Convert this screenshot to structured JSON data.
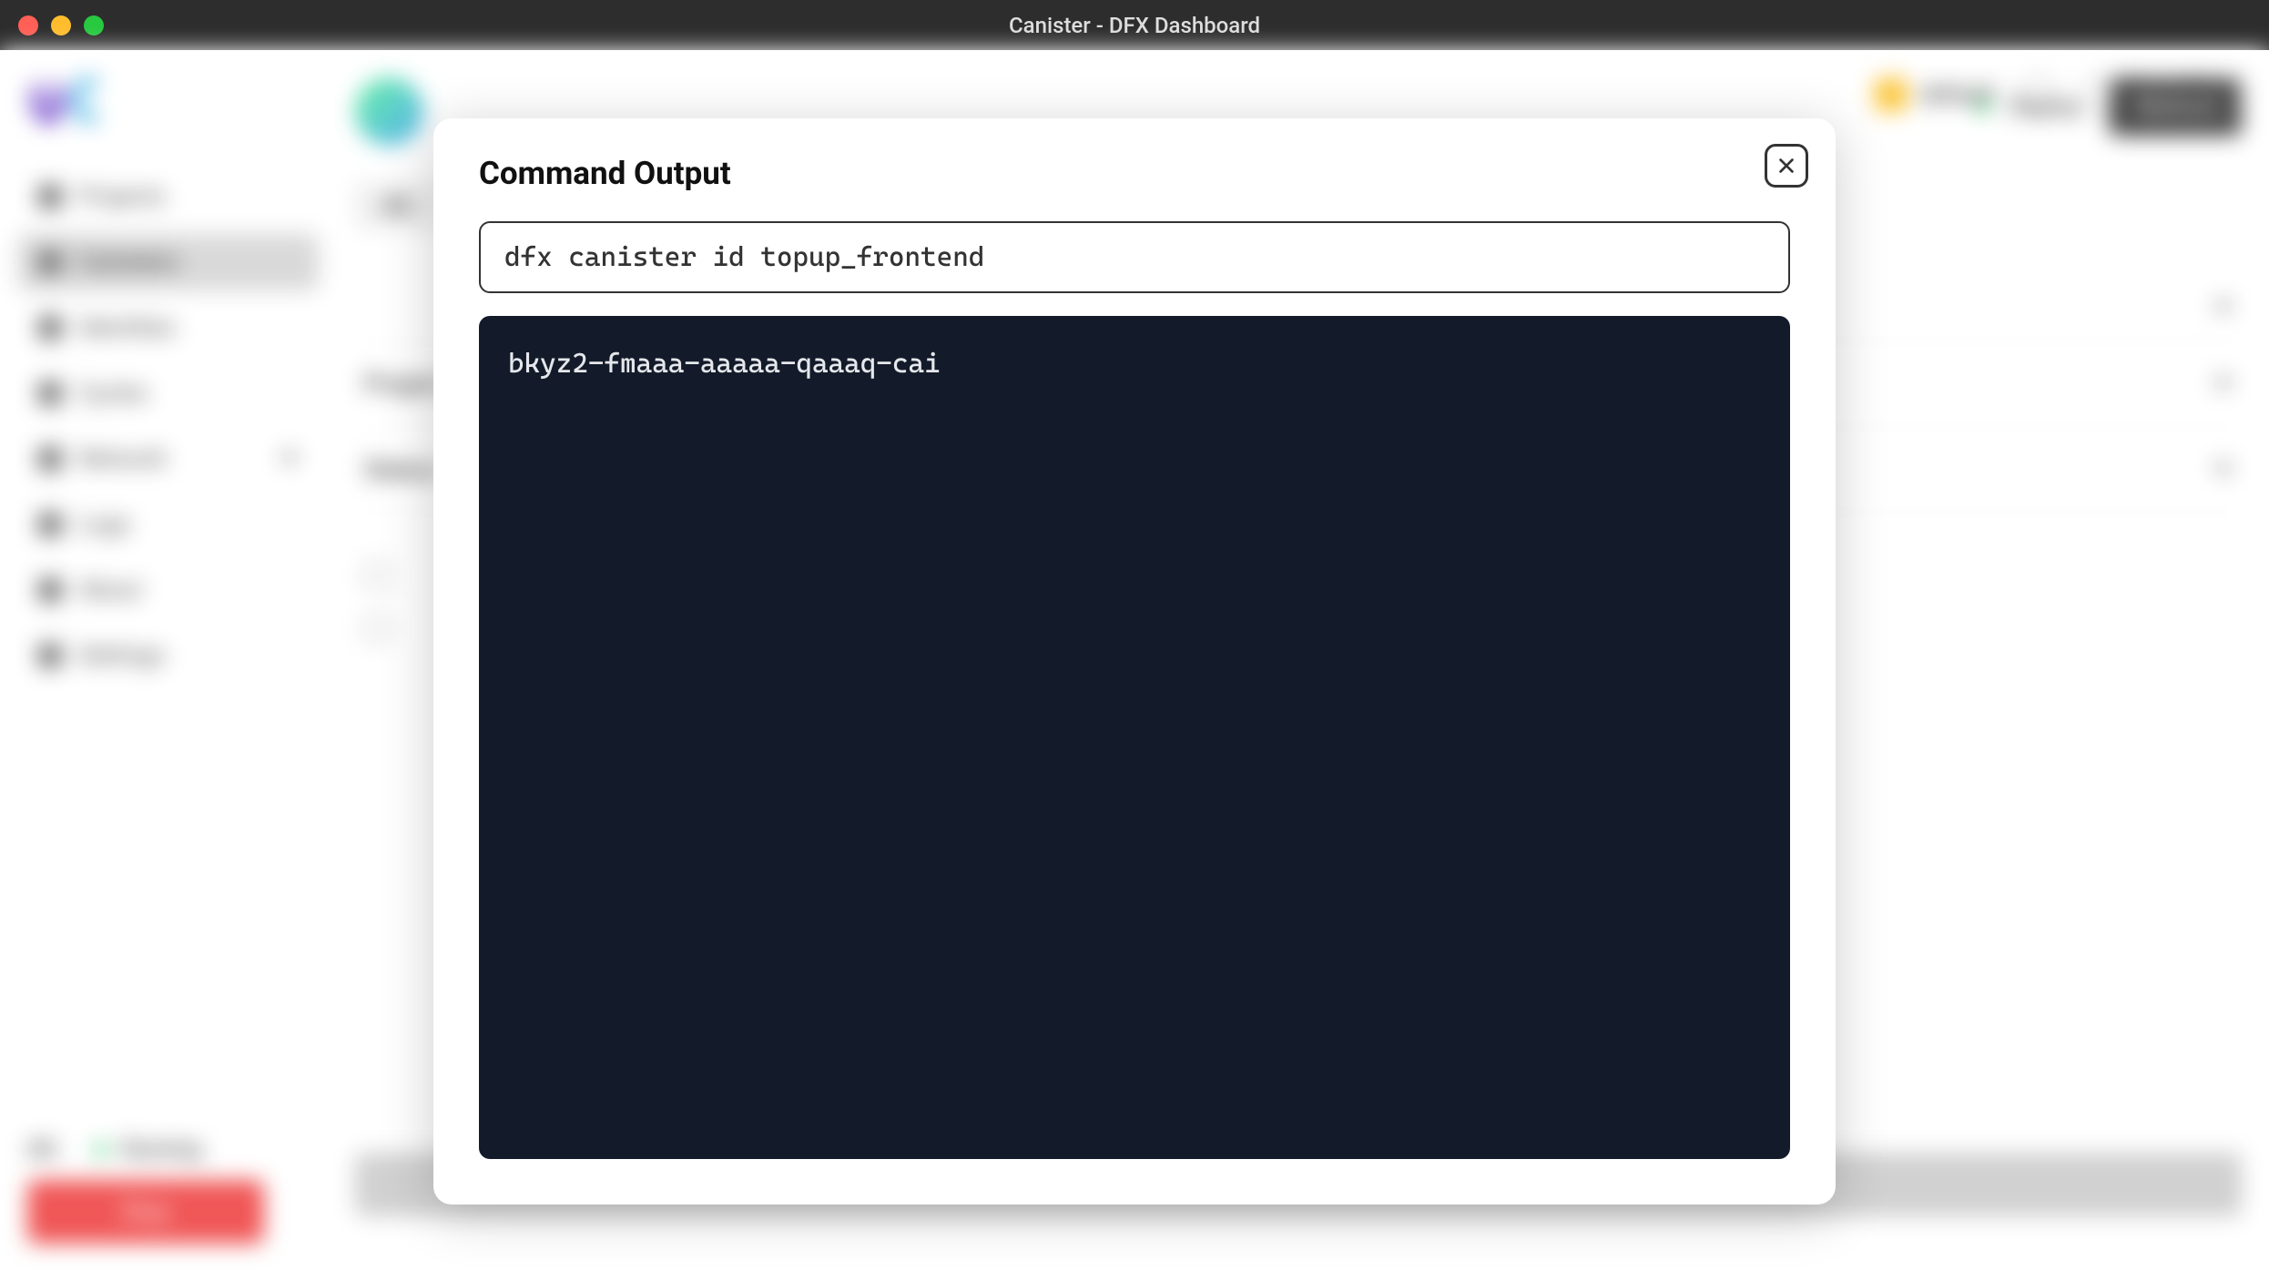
{
  "window": {
    "title": "Canister - DFX Dashboard"
  },
  "sidebar": {
    "items": [
      {
        "label": "Projects",
        "active": false
      },
      {
        "label": "Canisters",
        "active": true
      },
      {
        "label": "Identities",
        "active": false
      },
      {
        "label": "Cycles",
        "active": false
      },
      {
        "label": "Network",
        "active": false
      },
      {
        "label": "Logs",
        "active": false
      },
      {
        "label": "About",
        "active": false
      },
      {
        "label": "Settings",
        "active": false
      }
    ],
    "footer": {
      "dfx_label": "dfx",
      "status_label": "Running",
      "stop_label": "Stop"
    }
  },
  "topbar": {
    "user_label": "default"
  },
  "content": {
    "deploy_label": "Deploy",
    "remove_label": "Remove",
    "tab_label": "dfx",
    "sections": []
  },
  "modal": {
    "title": "Command Output",
    "command": "dfx canister id topup_frontend",
    "output": "bkyz2-fmaaa-aaaaa-qaaaq-cai"
  }
}
